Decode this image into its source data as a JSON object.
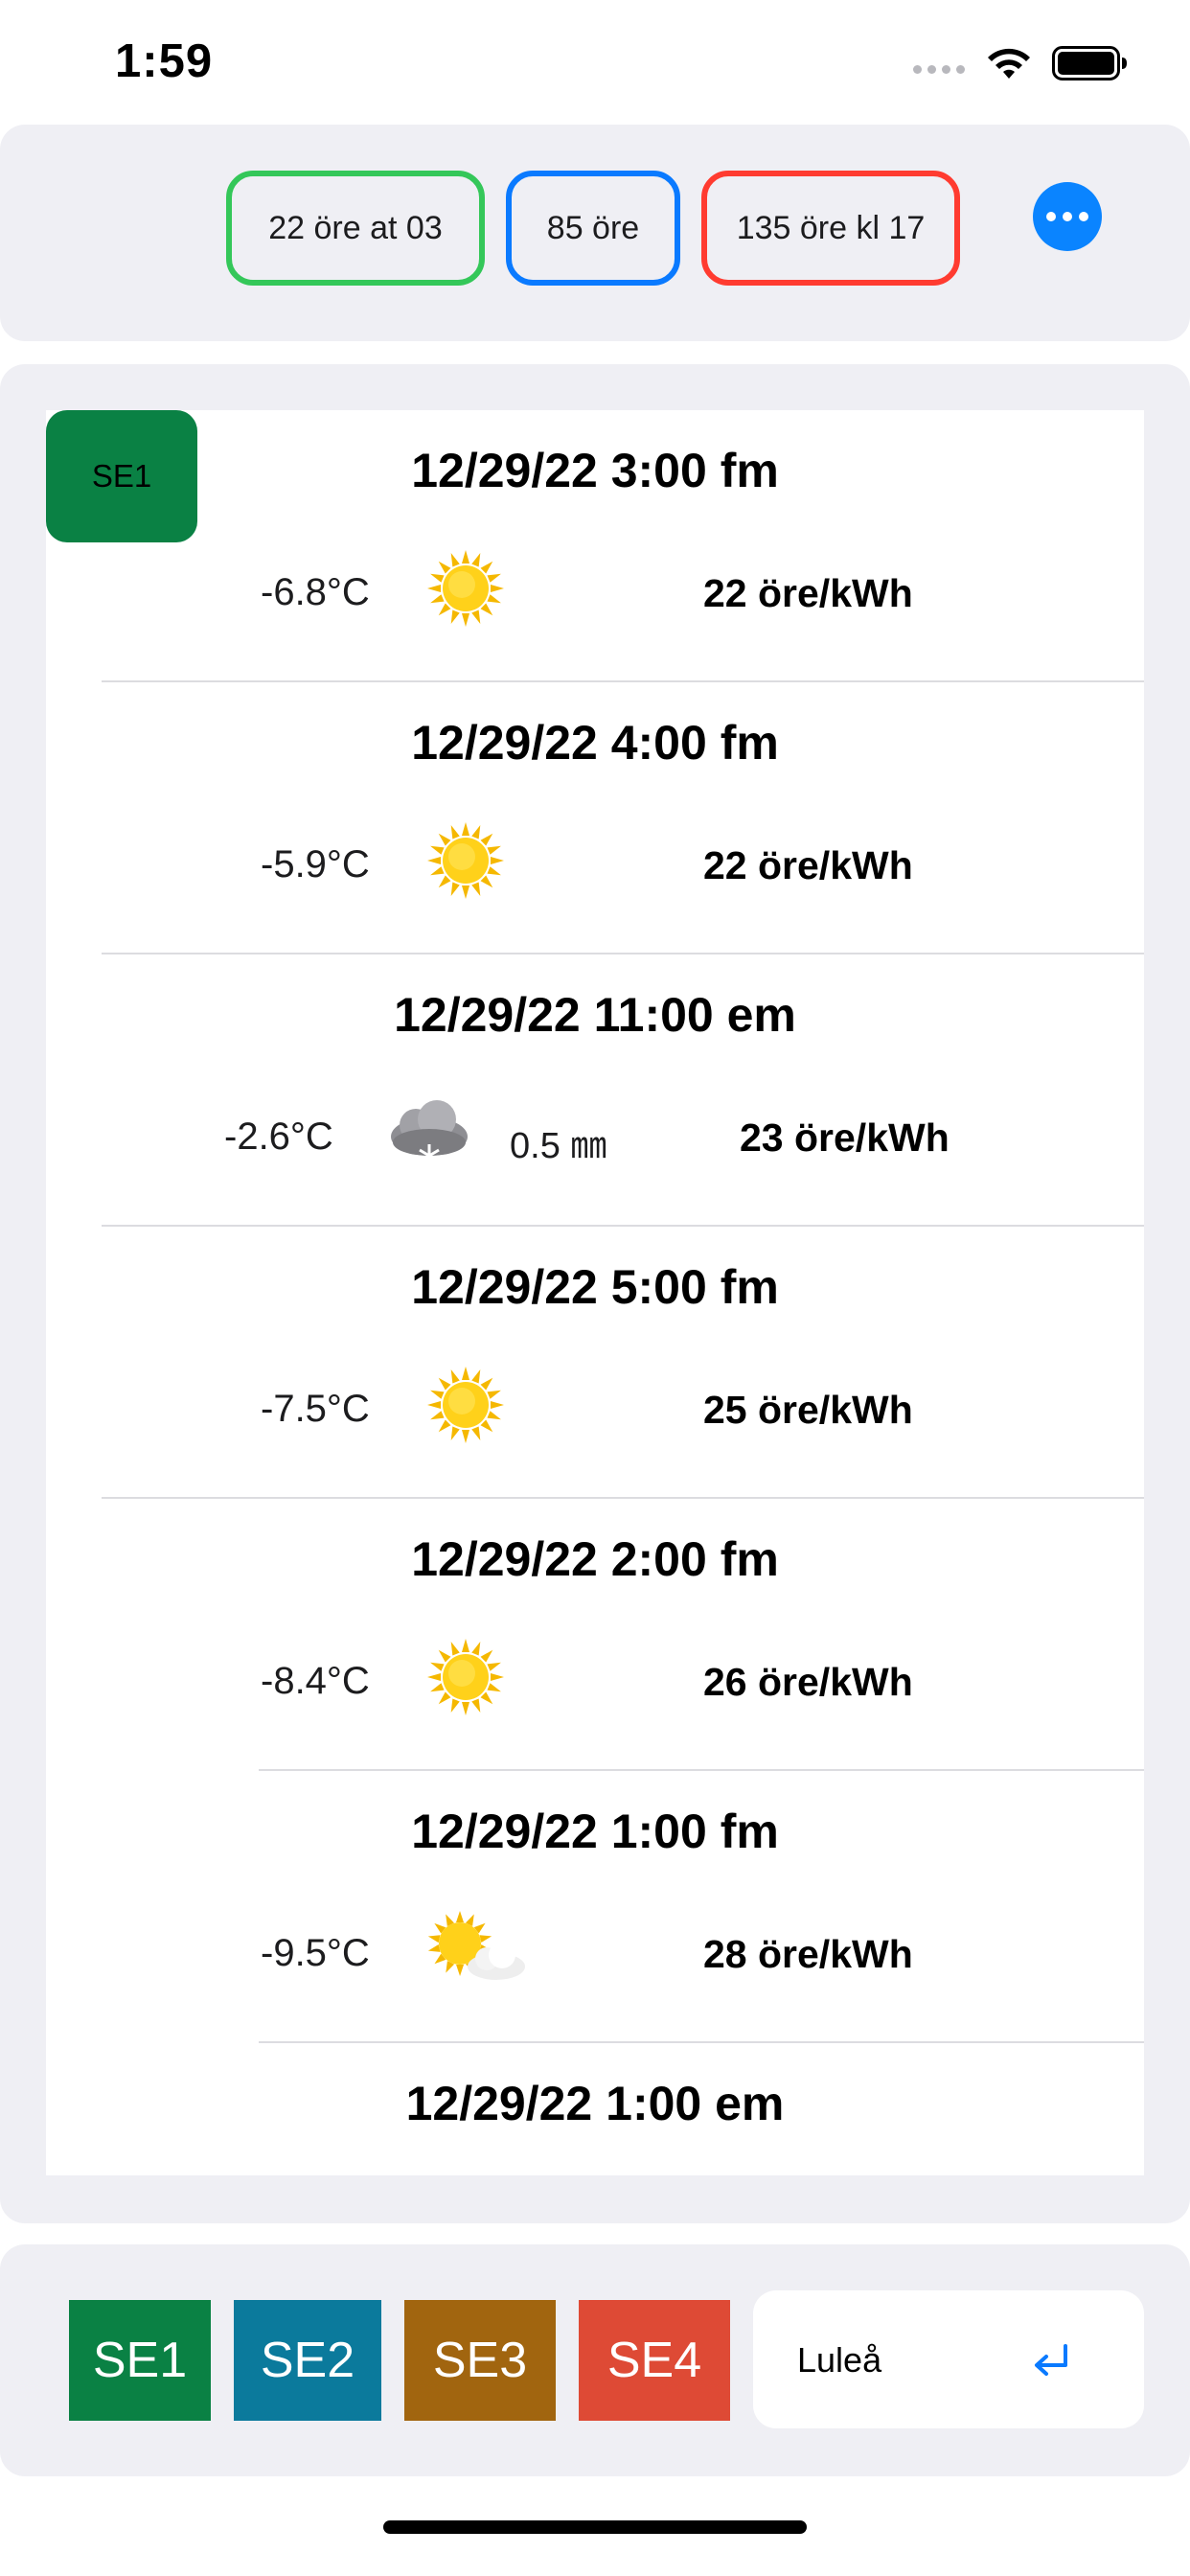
{
  "status_bar": {
    "time": "1:59"
  },
  "header": {
    "min_pill": "22 öre at 03",
    "avg_pill": "85 öre",
    "max_pill": "135 öre kl 17",
    "more_icon": "ellipsis-circle-icon"
  },
  "current_region": "SE1",
  "hours": [
    {
      "date": "12/29/22 3:00 fm",
      "temp": "-6.8°C",
      "icon": "sun-icon",
      "precip": "",
      "price": "22 öre/kWh"
    },
    {
      "date": "12/29/22 4:00 fm",
      "temp": "-5.9°C",
      "icon": "sun-icon",
      "precip": "",
      "price": "22 öre/kWh"
    },
    {
      "date": "12/29/22 11:00 em",
      "temp": "-2.6°C",
      "icon": "snow-cloud-icon",
      "precip": "0.5 ㎜",
      "price": "23 öre/kWh"
    },
    {
      "date": "12/29/22 5:00 fm",
      "temp": "-7.5°C",
      "icon": "sun-icon",
      "precip": "",
      "price": "25 öre/kWh"
    },
    {
      "date": "12/29/22 2:00 fm",
      "temp": "-8.4°C",
      "icon": "sun-icon",
      "precip": "",
      "price": "26 öre/kWh"
    },
    {
      "date": "12/29/22 1:00 fm",
      "temp": "-9.5°C",
      "icon": "partly-cloudy-icon",
      "precip": "",
      "price": "28 öre/kWh"
    },
    {
      "date": "12/29/22 1:00 em",
      "temp": "",
      "icon": "",
      "precip": "",
      "price": ""
    }
  ],
  "regions": [
    "SE1",
    "SE2",
    "SE3",
    "SE4"
  ],
  "region_colors": {
    "SE1": "#0a8144",
    "SE2": "#0b7a9c",
    "SE3": "#a1650f",
    "SE4": "#de4a35"
  },
  "city_input": {
    "value": "Luleå",
    "return_icon": "return-icon"
  },
  "accent_colors": {
    "min": "#34c759",
    "avg": "#0a7aff",
    "max": "#ff3b30"
  }
}
